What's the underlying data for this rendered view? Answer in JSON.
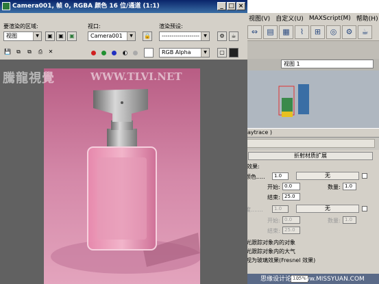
{
  "render_window": {
    "title": "Camera001, 帧 0, RGBA 颜色 16 位/通道 (1:1)",
    "area_label": "要渲染的区域:",
    "area_value": "视图",
    "viewport_label": "视口:",
    "viewport_value": "Camera001",
    "preset_label": "渲染预设:",
    "preset_value": "-------------------",
    "channel_value": "RGB Alpha"
  },
  "watermark": {
    "cn": "騰龍視覺",
    "url": "WWW.TLVI.NET"
  },
  "max_ui": {
    "menu": [
      "视图(V)",
      "自定义(U)",
      "MAXScript(M)",
      "帮助(H)"
    ],
    "view_select": "视图 1",
    "rollout_title": "aytrace )",
    "section_button": "折射材质扩展",
    "effect_label": "效果:",
    "color_label": "颜色.....",
    "none_label": "无",
    "start_label": "开始:",
    "end_label": "结束:",
    "amount_label": "数量:",
    "spinner_1": "1.0",
    "spinner_0": "0.0",
    "spinner_25": "25.0",
    "density_label": "度.......",
    "options": [
      "光跟踪对象内的对象",
      "光跟踪对象内的大气",
      "视为玻璃效果(Fresnel 效果)"
    ],
    "zoom": "105%",
    "bottom_watermark": "思缘设计论坛 www.MISSYUAN.COM"
  }
}
